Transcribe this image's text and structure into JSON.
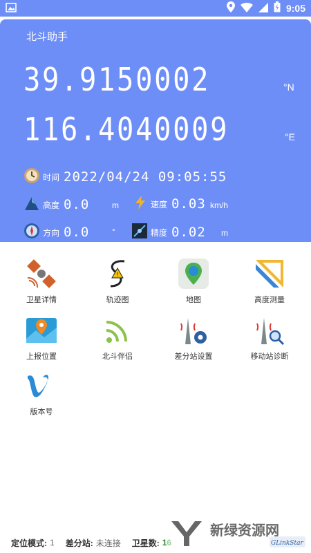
{
  "status_bar": {
    "time": "9:05"
  },
  "header": {
    "title": "北斗助手",
    "latitude": "39.9150002",
    "latitude_unit": "°N",
    "longitude": "116.4040009",
    "longitude_unit": "°E",
    "time": {
      "label": "时间",
      "value": "2022/04/24 09:05:55"
    },
    "altitude": {
      "label": "高度",
      "value": "0.0",
      "unit": "m"
    },
    "speed": {
      "label": "速度",
      "value": "0.03",
      "unit": "km/h"
    },
    "heading": {
      "label": "方向",
      "value": "0.0",
      "unit": "°"
    },
    "accuracy": {
      "label": "精度",
      "value": "0.02",
      "unit": "m"
    }
  },
  "menu": [
    {
      "label": "卫星详情",
      "icon": "satellite-icon"
    },
    {
      "label": "轨迹图",
      "icon": "track-icon"
    },
    {
      "label": "地图",
      "icon": "map-pin-icon"
    },
    {
      "label": "高度测量",
      "icon": "ruler-icon"
    },
    {
      "label": "上报位置",
      "icon": "report-location-icon"
    },
    {
      "label": "北斗伴侣",
      "icon": "signal-icon"
    },
    {
      "label": "差分站设置",
      "icon": "station-settings-icon"
    },
    {
      "label": "移动站诊断",
      "icon": "station-diagnose-icon"
    },
    {
      "label": "版本号",
      "icon": "version-icon"
    }
  ],
  "footer": {
    "mode_label": "定位模式:",
    "mode_value": "1",
    "station_label": "差分站:",
    "station_value": "未连接",
    "sat_label": "卫星数:",
    "sat_value": "16"
  },
  "watermark": {
    "text": "新绿资源网",
    "sub": "GLinkStar"
  },
  "colors": {
    "header_bg": "#6e8ef7",
    "accent_green": "#2e8b2e"
  }
}
